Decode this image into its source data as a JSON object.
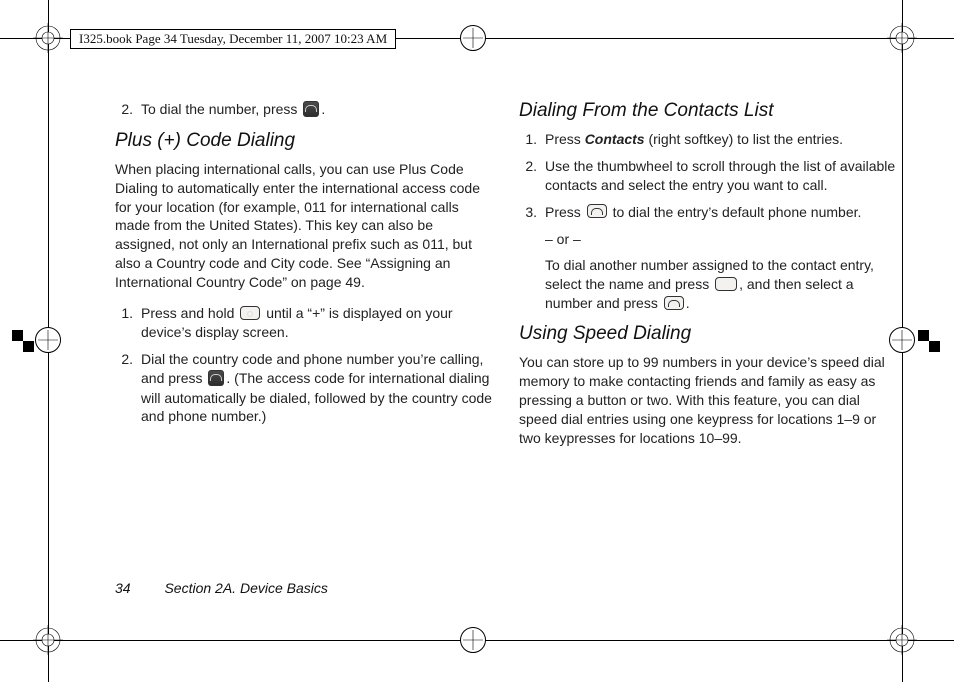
{
  "header": "I325.book  Page 34  Tuesday, December 11, 2007  10:23 AM",
  "footer": {
    "page": "34",
    "section": "Section 2A. Device Basics"
  },
  "left": {
    "step2": "To dial the number, press ",
    "step2_after": ".",
    "h_plus": "Plus (+) Code Dialing",
    "plus_body": "When placing international calls, you can use Plus Code Dialing to automatically enter the international access code for your location (for example, 011 for international calls made from the United States). This key can also be assigned, not only an International prefix such as 011, but also a Country code and City code. See “Assigning an International Country Code” on page 49.",
    "steps": [
      {
        "n": "1.",
        "pre": "Press and hold ",
        "post": " until a “+” is displayed on your device’s display screen."
      },
      {
        "n": "2.",
        "pre": "Dial the country code and phone number you’re calling, and press ",
        "post": ". (The access code for international dialing will automatically be dialed, followed by the country code and phone number.)"
      }
    ]
  },
  "right": {
    "h_contacts": "Dialing From the Contacts List",
    "steps": [
      {
        "n": "1.",
        "pre": "Press ",
        "btn": "Contacts",
        "post": " (right softkey) to list the entries."
      },
      {
        "n": "2.",
        "txt": "Use the thumbwheel to scroll through the list of available contacts and select the entry you want to call."
      },
      {
        "n": "3.",
        "pre": "Press ",
        "post": " to dial the entry’s default phone number."
      }
    ],
    "or": "– or –",
    "alt_pre": "To dial another number assigned to the contact entry, select the name and press ",
    "alt_mid": ", and then select a number and press ",
    "alt_post": ".",
    "h_speed": "Using Speed Dialing",
    "speed_body": "You can store up to 99 numbers in your device’s speed dial memory to make contacting friends and family as easy as pressing a button or two. With this feature, you can dial speed dial entries using one keypress for locations 1–9 or two keypresses for locations 10–99."
  }
}
